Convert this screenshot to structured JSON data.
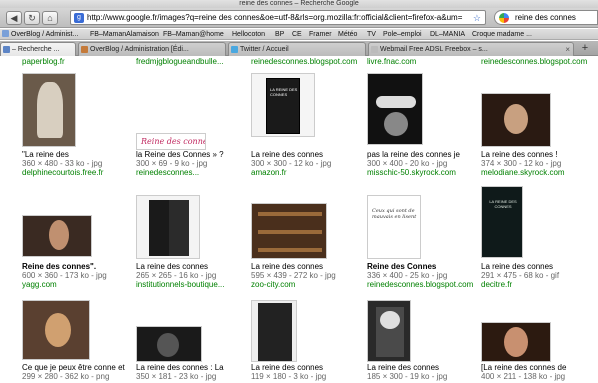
{
  "window": {
    "title": "reine des connes – Recherche Google"
  },
  "toolbar": {
    "url": "http://www.google.fr/images?q=reine des connes&oe=utf-8&rls=org.mozilla:fr:official&client=firefox-a&um=",
    "search_value": "reine des connes"
  },
  "bookmarks": [
    {
      "label": "OverBlog / Administ..."
    },
    {
      "label": "FB–MamanAlamaison"
    },
    {
      "label": "FB–Maman@home"
    },
    {
      "label": "Hellocoton"
    },
    {
      "label": "BP"
    },
    {
      "label": "CE"
    },
    {
      "label": "Framer"
    },
    {
      "label": "Météo"
    },
    {
      "label": "TV"
    },
    {
      "label": "Pole–emploi"
    },
    {
      "label": "DL–MANIA"
    },
    {
      "label": "Croque madame ..."
    }
  ],
  "tabs": [
    {
      "label": "– Recherche ..."
    },
    {
      "label": "OverBlog / Administration [Édi..."
    },
    {
      "label": "Twitter / Accueil"
    },
    {
      "label": "Webmail Free ADSL Freebox – s..."
    }
  ],
  "top_sites": [
    "paperblog.fr",
    "fredmjgblogueandbulle...",
    "reinedesconnes.blogspot.com",
    "livre.fnac.com",
    "reinedesconnes.blogspot.com"
  ],
  "results": [
    {
      "title": "\"La reine des",
      "meta": "360 × 480 - 33 ko - jpg",
      "site": "delphinecourtois.free.fr",
      "thumb_color": "#6a5a4a",
      "accent": "#d8cfc0"
    },
    {
      "title": "la Reine des Connes » ?",
      "meta": "300 × 69 - 9 ko - jpg",
      "site": "reinedesconnes...",
      "thumb_color": "#ffffff",
      "accent": "#c0285f",
      "thumb_text": "Reine des connes"
    },
    {
      "title": "La reine des connes",
      "meta": "300 × 300 - 12 ko - jpg",
      "site": "amazon.fr",
      "thumb_color": "#f5f5f5",
      "accent": "#1a1a1a",
      "thumb_text": "LA REINE DES CONNES"
    },
    {
      "title": "pas la reine des connes je",
      "meta": "300 × 400 - 20 ko - jpg",
      "site": "misschic-50.skyrock.com",
      "thumb_color": "#111111",
      "accent": "#dddddd"
    },
    {
      "title": "La reine des connes !",
      "meta": "374 × 300 - 12 ko - jpg",
      "site": "melodiane.skyrock.com",
      "thumb_color": "#2a1a12",
      "accent": "#c8a080"
    },
    {
      "title": "Reine des connes\".",
      "meta": "600 × 360 - 173 ko - jpg",
      "site": "yagg.com",
      "thumb_color": "#3a2a22",
      "accent": "#c09070"
    },
    {
      "title": "La reine des connes",
      "meta": "265 × 265 - 16 ko - jpg",
      "site": "institutionnels-boutique...",
      "thumb_color": "#f4f4f4",
      "accent": "#1a1a1a"
    },
    {
      "title": "La reine des connes",
      "meta": "595 × 439 - 272 ko - jpg",
      "site": "zoo-city.com",
      "thumb_color": "#4a2f1c",
      "accent": "#9a6a3a"
    },
    {
      "title": "Reine des Connes",
      "meta": "336 × 400 - 25 ko - jpg",
      "site": "reinedesconnes.blogspot.com",
      "thumb_color": "#ffffff",
      "accent": "#333333",
      "thumb_text": "Ceux qui sont de mauvais en lisent"
    },
    {
      "title": "La reine des connes",
      "meta": "291 × 475 - 68 ko - gif",
      "site": "decitre.fr",
      "thumb_color": "#0f1a1a",
      "accent": "#dfe8e0",
      "thumb_text": "LA REINE DES CONNES"
    },
    {
      "title": "Ce que je peux être conne et",
      "meta": "299 × 280 - 362 ko - png",
      "site": "",
      "thumb_color": "#5a4030",
      "accent": "#d0a070"
    },
    {
      "title": "La reine des connes : La",
      "meta": "350 × 181 - 23 ko - jpg",
      "site": "",
      "thumb_color": "#1a1a1a",
      "accent": "#555555"
    },
    {
      "title": "La reine des connes",
      "meta": "119 × 180 - 3 ko - jpg",
      "site": "",
      "thumb_color": "#eeeeee",
      "accent": "#222222"
    },
    {
      "title": "La reine des connes",
      "meta": "185 × 300 - 19 ko - jpg",
      "site": "",
      "thumb_color": "#2a2a2a",
      "accent": "#e0e0e0"
    },
    {
      "title": "[La reine des connes de",
      "meta": "400 × 211 - 138 ko - jpg",
      "site": "",
      "thumb_color": "#2c1a10",
      "accent": "#c89070"
    }
  ]
}
